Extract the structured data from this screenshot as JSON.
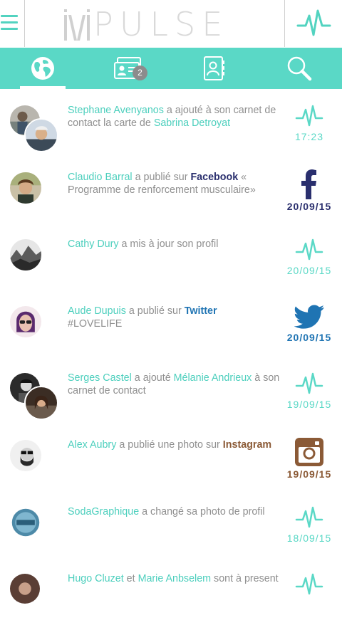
{
  "app": {
    "logo_text": "PULSE"
  },
  "colors": {
    "accent": "#5ad8c6",
    "facebook": "#2a2f6e",
    "twitter": "#1f74b3",
    "instagram": "#8b5a36"
  },
  "tabs": [
    {
      "icon": "globe-icon",
      "active": true
    },
    {
      "icon": "contact-cards-icon",
      "badge": "2"
    },
    {
      "icon": "address-book-icon"
    },
    {
      "icon": "search-icon"
    }
  ],
  "feed": [
    {
      "parts": [
        "Stephane Avenyanos",
        " a ajouté à son carnet de contact la carte de ",
        "Sabrina Detroyat"
      ],
      "icon": "pulse-icon",
      "time": "17:23"
    },
    {
      "parts": [
        "Claudio Barral",
        " a publié sur ",
        "Facebook",
        " « Programme de renforcement musculaire»"
      ],
      "icon": "facebook-icon",
      "time": "20/09/15"
    },
    {
      "parts": [
        "Cathy Dury",
        " a mis à jour son profil"
      ],
      "icon": "pulse-icon",
      "time": "20/09/15"
    },
    {
      "parts": [
        "Aude Dupuis",
        " a publié sur ",
        "Twitter",
        " #LOVELIFE"
      ],
      "icon": "twitter-icon",
      "time": "20/09/15"
    },
    {
      "parts": [
        "Serges Castel",
        " a ajouté ",
        "Mélanie Andrieux",
        " à son carnet de contact"
      ],
      "icon": "pulse-icon",
      "time": "19/09/15"
    },
    {
      "parts": [
        "Alex Aubry",
        " a publié une photo sur ",
        "Instagram"
      ],
      "icon": "instagram-icon",
      "time": "19/09/15"
    },
    {
      "parts": [
        "SodaGraphique",
        " a changé sa photo de profil"
      ],
      "icon": "pulse-icon",
      "time": "18/09/15"
    },
    {
      "parts": [
        "Hugo Cluzet",
        " et ",
        "Marie Anbselem",
        " sont à present"
      ],
      "icon": "pulse-icon",
      "time": ""
    }
  ]
}
